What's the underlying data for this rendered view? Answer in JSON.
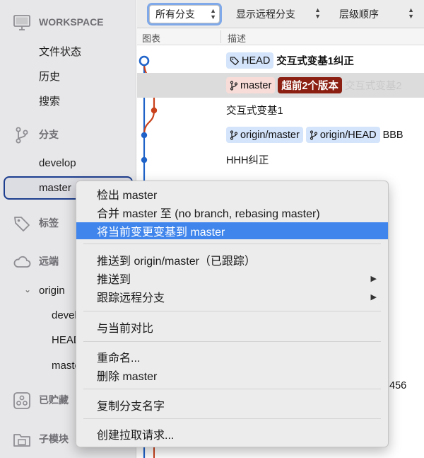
{
  "sidebar": {
    "workspace": {
      "title": "WORKSPACE",
      "items": [
        "文件状态",
        "历史",
        "搜索"
      ]
    },
    "branches": {
      "title": "分支",
      "items": [
        "develop",
        "master"
      ]
    },
    "tags": {
      "title": "标签"
    },
    "remotes": {
      "title": "远端",
      "origin": "origin",
      "items": [
        "develop",
        "HEAD",
        "master"
      ]
    },
    "stashes": {
      "title": "已贮藏"
    },
    "submodules": {
      "title": "子模块"
    }
  },
  "toolbar": {
    "branch_filter": "所有分支",
    "remote_filter": "显示远程分支",
    "order": "层级顺序"
  },
  "columns": {
    "graph": "图表",
    "description": "描述"
  },
  "commits": [
    {
      "tags": [
        {
          "label": "HEAD",
          "style": "blue",
          "icon": "tag-icon"
        }
      ],
      "message": "交互式变基1纠正",
      "bold": true
    },
    {
      "tags": [
        {
          "label": "master",
          "style": "pink",
          "icon": "branch-icon"
        },
        {
          "label": "超前2个版本",
          "style": "dark"
        }
      ],
      "message": "交互式变基2",
      "light": true
    },
    {
      "tags": [],
      "message": "交互式变基1"
    },
    {
      "tags": [
        {
          "label": "origin/master",
          "style": "blue",
          "icon": "branch-icon"
        },
        {
          "label": "origin/HEAD",
          "style": "blue",
          "icon": "branch-icon"
        }
      ],
      "message": "BBB"
    },
    {
      "tags": [],
      "message": "HHH纠正"
    }
  ],
  "peek_text": "456",
  "context_menu": {
    "items": [
      {
        "label": "检出 master"
      },
      {
        "label": "合并 master 至 (no branch, rebasing master)"
      },
      {
        "label": "将当前变更变基到 master",
        "highlighted": true
      },
      {
        "label": "推送到 origin/master（已跟踪）"
      },
      {
        "label": "推送到",
        "submenu": true
      },
      {
        "label": "跟踪远程分支",
        "submenu": true
      },
      {
        "label": "与当前对比"
      },
      {
        "label": "重命名..."
      },
      {
        "label": "删除 master"
      },
      {
        "label": "复制分支名字"
      },
      {
        "label": "创建拉取请求..."
      }
    ]
  },
  "colors": {
    "accent": "#3f85ec",
    "graph_blue": "#1f63c9",
    "graph_red": "#c8411b",
    "ahead_badge": "#8a1f12"
  }
}
